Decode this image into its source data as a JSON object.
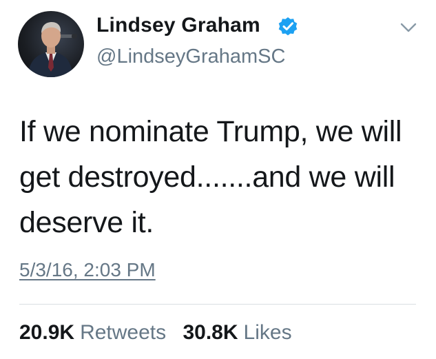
{
  "colors": {
    "text_primary": "#14171a",
    "text_secondary": "#657786",
    "verified_badge": "#1da1f2",
    "divider": "#d9dee2"
  },
  "user": {
    "display_name": "Lindsey Graham",
    "handle": "@LindseyGrahamSC",
    "verified_icon": "verified-badge-icon",
    "menu_icon": "chevron-down-icon"
  },
  "tweet": {
    "text": "If we nominate Trump, we will get destroyed.......and we will deserve it.",
    "timestamp": "5/3/16, 2:03 PM"
  },
  "stats": {
    "retweets_count": "20.9K",
    "retweets_label": "Retweets",
    "likes_count": "30.8K",
    "likes_label": "Likes"
  }
}
